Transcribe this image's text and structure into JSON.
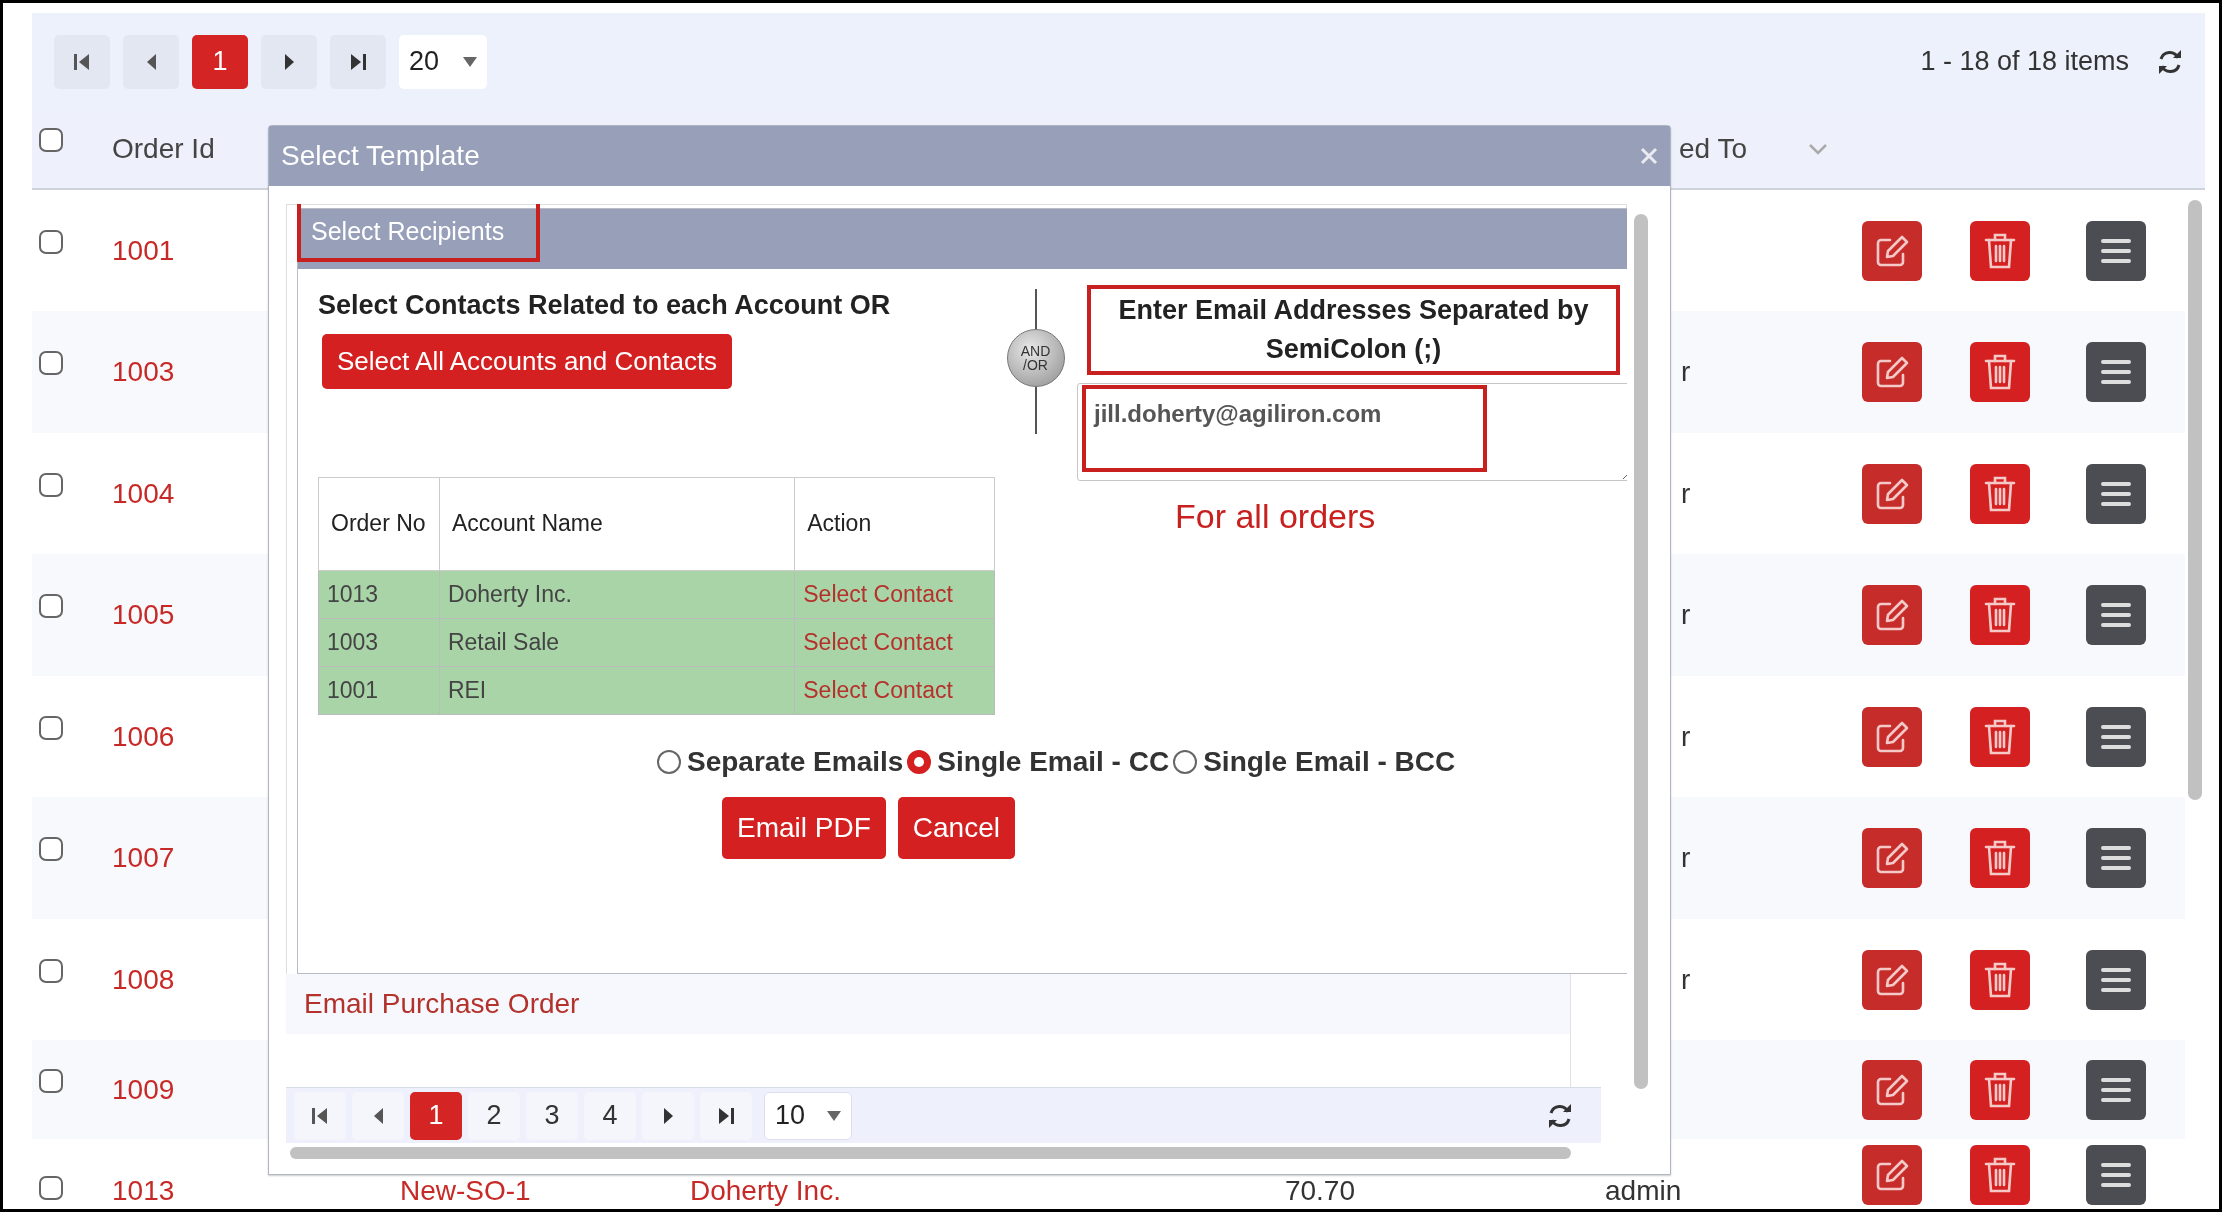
{
  "pager": {
    "pages": [
      {
        "label": "1",
        "selected": true
      }
    ],
    "page_size": "20",
    "summary": "1 - 18 of 18 items"
  },
  "table": {
    "header_checked": false,
    "columns": [
      {
        "kind": "order",
        "label": "Order Id"
      },
      {
        "kind": "assigned",
        "label": "ed To"
      }
    ],
    "rows": [
      {
        "checked": false,
        "order_id": "1001"
      },
      {
        "checked": false,
        "order_id": "1003",
        "assigned_to": "r"
      },
      {
        "checked": false,
        "order_id": "1004",
        "assigned_to": "r"
      },
      {
        "checked": false,
        "order_id": "1005",
        "assigned_to": "r"
      },
      {
        "checked": false,
        "order_id": "1006",
        "assigned_to": "r"
      },
      {
        "checked": false,
        "order_id": "1007",
        "assigned_to": "r"
      },
      {
        "checked": false,
        "order_id": "1008",
        "assigned_to": "r"
      },
      {
        "checked": false,
        "order_id": "1009"
      },
      {
        "checked": false,
        "order_id": "1013",
        "column_3": "New-SO-1",
        "column_4": "Doherty Inc.",
        "column_5": "70.70",
        "assigned_to": "admin"
      }
    ]
  },
  "modal": {
    "title": "Select Template",
    "panel": {
      "title": "Select Recipients",
      "left_heading": "Select Contacts Related to each Account OR",
      "select_all_button": "Select All Accounts and Contacts",
      "and_or": [
        "AND",
        "/OR"
      ],
      "email_heading": "Enter Email Addresses Separated by SemiColon (;)",
      "email_value": "jill.doherty@agiliron.com",
      "note": "For all orders",
      "contacts_table": {
        "columns": [
          "Order No",
          "Account Name",
          "Action"
        ],
        "rows": [
          {
            "order_no": "1013",
            "account_name": "Doherty Inc.",
            "action": "Select Contact"
          },
          {
            "order_no": "1003",
            "account_name": "Retail Sale",
            "action": "Select Contact"
          },
          {
            "order_no": "1001",
            "account_name": "REI",
            "action": "Select Contact"
          }
        ]
      },
      "send_options": [
        {
          "label": "Separate Emails",
          "selected": false
        },
        {
          "label": "Single Email - CC",
          "selected": true
        },
        {
          "label": "Single Email - BCC",
          "selected": false
        }
      ],
      "buttons": [
        "Email PDF",
        "Cancel"
      ]
    },
    "grid_row": "Email Purchase Order",
    "pager": {
      "pages": [
        {
          "label": "1",
          "selected": true
        },
        {
          "label": "2",
          "selected": false
        },
        {
          "label": "3",
          "selected": false
        },
        {
          "label": "4",
          "selected": false
        }
      ],
      "page_size": "10"
    }
  }
}
